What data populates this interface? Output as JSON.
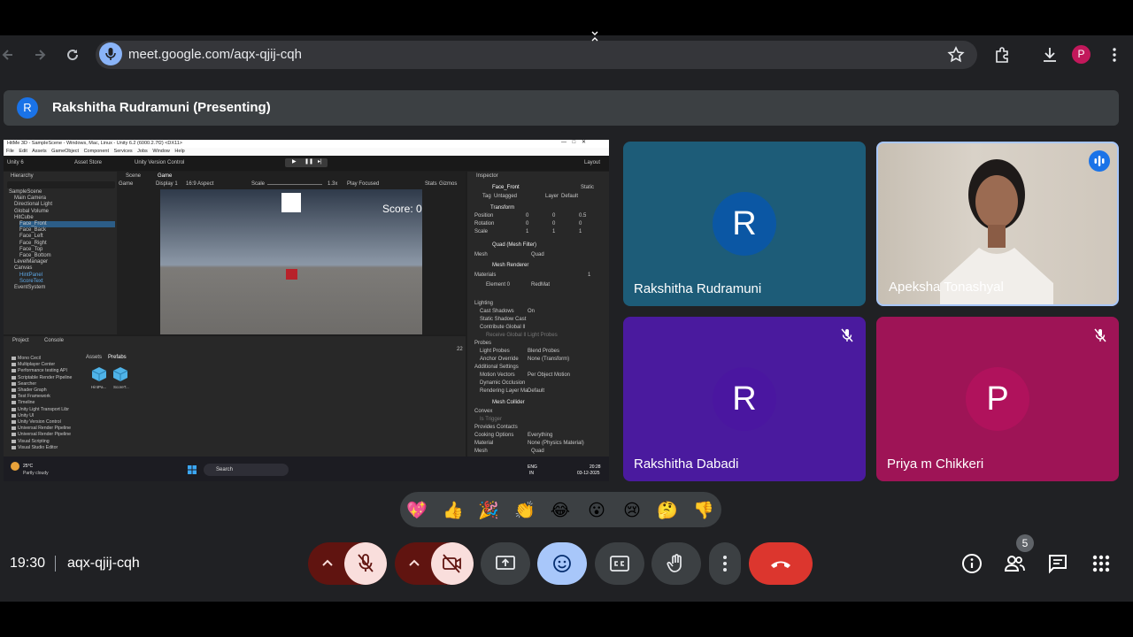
{
  "browser": {
    "url": "meet.google.com/aqx-qjij-cqh",
    "profile_initial": "P"
  },
  "presenting": {
    "avatar_initial": "R",
    "title": "Rakshitha Rudramuni (Presenting)"
  },
  "shared_screen": {
    "window_title": "HitMe 3D - SampleScene - Windows, Mac, Linux - Unity 6.2 (6000.2.7f2) <DX11>",
    "menu": [
      "File",
      "Edit",
      "Assets",
      "GameObject",
      "Component",
      "Services",
      "Jobs",
      "Window",
      "Help"
    ],
    "toolbar": {
      "account": "Unity 6",
      "asset_store": "Asset Store",
      "version_control": "Unity Version Control",
      "layout": "Layout"
    },
    "hierarchy": {
      "tab": "Hierarchy",
      "items": [
        "SampleScene",
        "Main Camera",
        "Directional Light",
        "Global Volume",
        "HitCube",
        "Face_Front",
        "Face_Back",
        "Face_Left",
        "Face_Right",
        "Face_Top",
        "Face_Bottom",
        "LevelManager",
        "Canvas",
        "HintPanel",
        "ScoreText",
        "EventSystem"
      ]
    },
    "scene_tabs": [
      "Scene",
      "Game"
    ],
    "game_bar": {
      "mode": "Game",
      "display": "Display 1",
      "aspect": "16:9 Aspect",
      "scale": "Scale",
      "scale_value": "1.3x",
      "play_focused": "Play Focused",
      "stats": "Stats",
      "gizmos": "Gizmos"
    },
    "game_score": "Score: 0",
    "inspector": {
      "tab": "Inspector",
      "object": "Face_Front",
      "static": "Static",
      "tag_label": "Tag",
      "tag": "Untagged",
      "layer_label": "Layer",
      "layer": "Default",
      "transform": "Transform",
      "rows": [
        {
          "label": "Position",
          "x": "0",
          "y": "0",
          "z": "0.5"
        },
        {
          "label": "Rotation",
          "x": "0",
          "y": "0",
          "z": "0"
        },
        {
          "label": "Scale",
          "x": "1",
          "y": "1",
          "z": "1"
        }
      ],
      "mesh_filter": "Quad (Mesh Filter)",
      "mesh_label": "Mesh",
      "mesh_value": "Quad",
      "mesh_renderer": "Mesh Renderer",
      "materials": "Materials",
      "materials_count": "1",
      "element0": "Element 0",
      "element0_value": "RedMat",
      "lighting": "Lighting",
      "cast_shadows": "Cast Shadows",
      "cast_shadows_value": "On",
      "static_shadow": "Static Shadow Cast",
      "contribute_gi": "Contribute Global Il",
      "receive_gi": "Receive Global Il",
      "receive_gi_value": "Light Probes",
      "probes": "Probes",
      "light_probes": "Light Probes",
      "light_probes_value": "Blend Probes",
      "anchor_override": "Anchor Override",
      "anchor_value": "None (Transform)",
      "additional": "Additional Settings",
      "motion_vectors": "Motion Vectors",
      "motion_value": "Per Object Motion",
      "dynamic_occlusion": "Dynamic Occlusion",
      "rendering_layer": "Rendering Layer Ma",
      "rendering_layer_value": "Default",
      "mesh_collider": "Mesh Collider",
      "convex": "Convex",
      "is_trigger": "Is Trigger",
      "provides_contacts": "Provides Contacts",
      "cooking": "Cooking Options",
      "cooking_value": "Everything",
      "material": "Material",
      "material_value": "None (Physics Material)",
      "mesh2": "Mesh",
      "mesh2_value": "Quad"
    },
    "project": {
      "tabs": [
        "Project",
        "Console"
      ],
      "folders": [
        "Mono Cecil",
        "Multiplayer Center",
        "Performance testing API",
        "Scriptable Render Pipeline",
        "Searcher",
        "Shader Graph",
        "Test Framework",
        "Timeline",
        "Unity Light Transport Libr",
        "Unity UI",
        "Unity Version Control",
        "Universal Render Pipeline",
        "Universal Render Pipeline",
        "Visual Scripting",
        "Visual Studio Editor"
      ],
      "breadcrumb": [
        "Assets",
        "Prefabs"
      ],
      "assets": [
        "HintPa...",
        "ScoreT..."
      ],
      "count": "22"
    },
    "taskbar": {
      "temp": "25°C",
      "weather": "Partly cloudy",
      "search": "Search",
      "lang1": "ENG",
      "lang2": "IN",
      "time": "20:28",
      "date": "03-12-2025"
    }
  },
  "participants": [
    {
      "name": "Rakshitha Rudramuni",
      "initial": "R",
      "muted": false,
      "bg": "#1d5c78",
      "avatar_bg": "#0b57a4"
    },
    {
      "name": "Apeksha Tonashyal",
      "initial": "",
      "muted": false,
      "speaking": true
    },
    {
      "name": "Rakshitha Dabadi",
      "initial": "R",
      "muted": true,
      "bg": "#4a1a9e",
      "avatar_bg": "#4a16a0"
    },
    {
      "name": "Priya m Chikkeri",
      "initial": "P",
      "muted": true,
      "bg": "#9e1456",
      "avatar_bg": "#b0125c"
    }
  ],
  "reactions": [
    "💖",
    "👍",
    "🎉",
    "👏",
    "😂",
    "😮",
    "😢",
    "🤔",
    "👎"
  ],
  "footer": {
    "time": "19:30",
    "meeting_code": "aqx-qjij-cqh",
    "participants_count": "5"
  },
  "colors": {
    "accent": "#8ab4f8",
    "hangup": "#dc362e",
    "muted_btn": "#f9dedc",
    "muted_dark": "#601410"
  }
}
